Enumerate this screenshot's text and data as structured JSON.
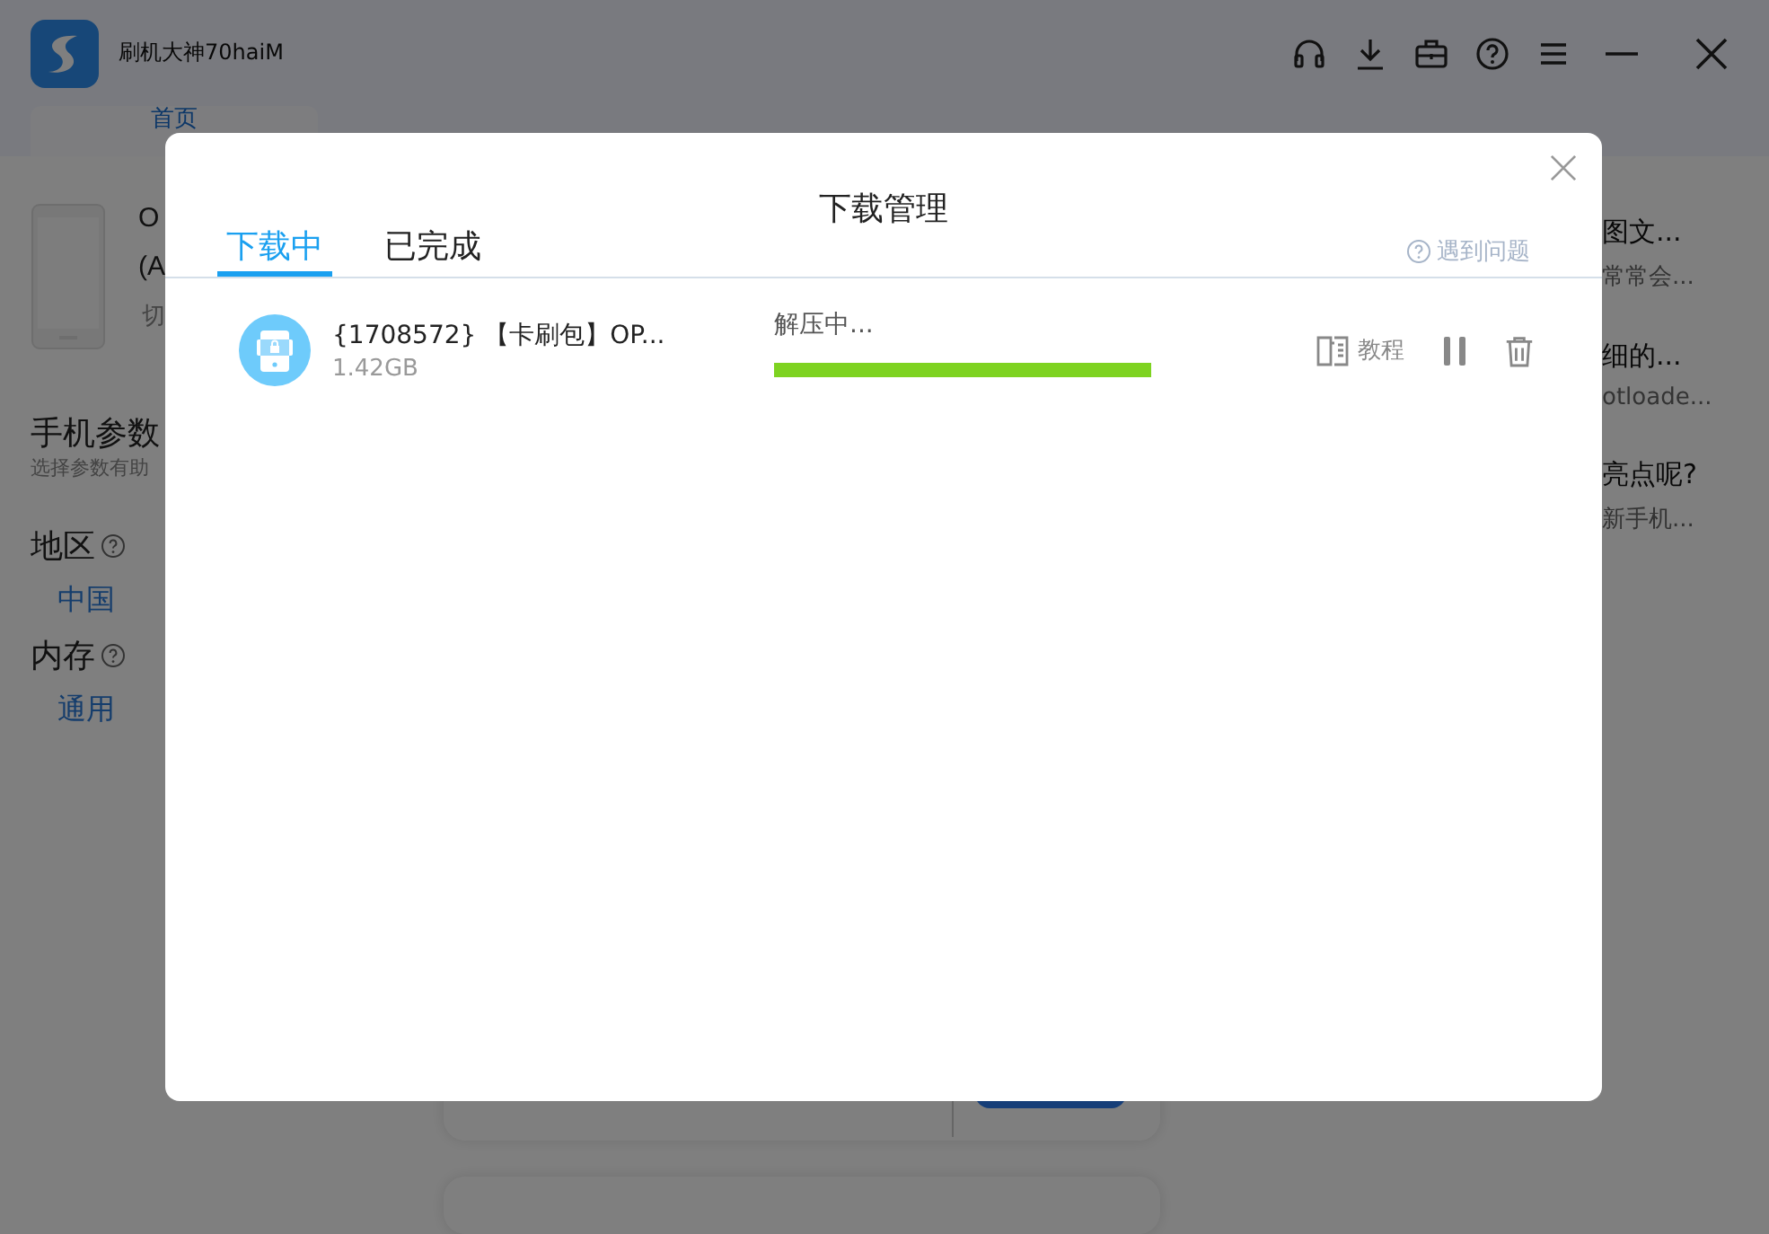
{
  "app": {
    "title": "刷机大神70haiM",
    "tab": "首页"
  },
  "background_left": {
    "device_lines": [
      "O",
      "(A",
      "切"
    ],
    "section_title": "手机参数",
    "section_hint": "选择参数有助",
    "params": [
      {
        "label": "地区",
        "value": "中国"
      },
      {
        "label": "内存",
        "value": "通用"
      }
    ]
  },
  "background_right": [
    {
      "title": "图文...",
      "subtitle": "常常会..."
    },
    {
      "title": "细的...",
      "subtitle": "otloade..."
    },
    {
      "title": "亮点呢?",
      "subtitle": "新手机..."
    }
  ],
  "dialog": {
    "title": "下载管理",
    "tabs": [
      {
        "label": "下载中",
        "selected": true
      },
      {
        "label": "已完成",
        "selected": false
      }
    ],
    "help": "遇到问题",
    "downloads": [
      {
        "name": "{1708572} 【卡刷包】OP...",
        "size": "1.42GB",
        "status": "解压中...",
        "level": 1,
        "tutorial": "教程"
      }
    ]
  }
}
